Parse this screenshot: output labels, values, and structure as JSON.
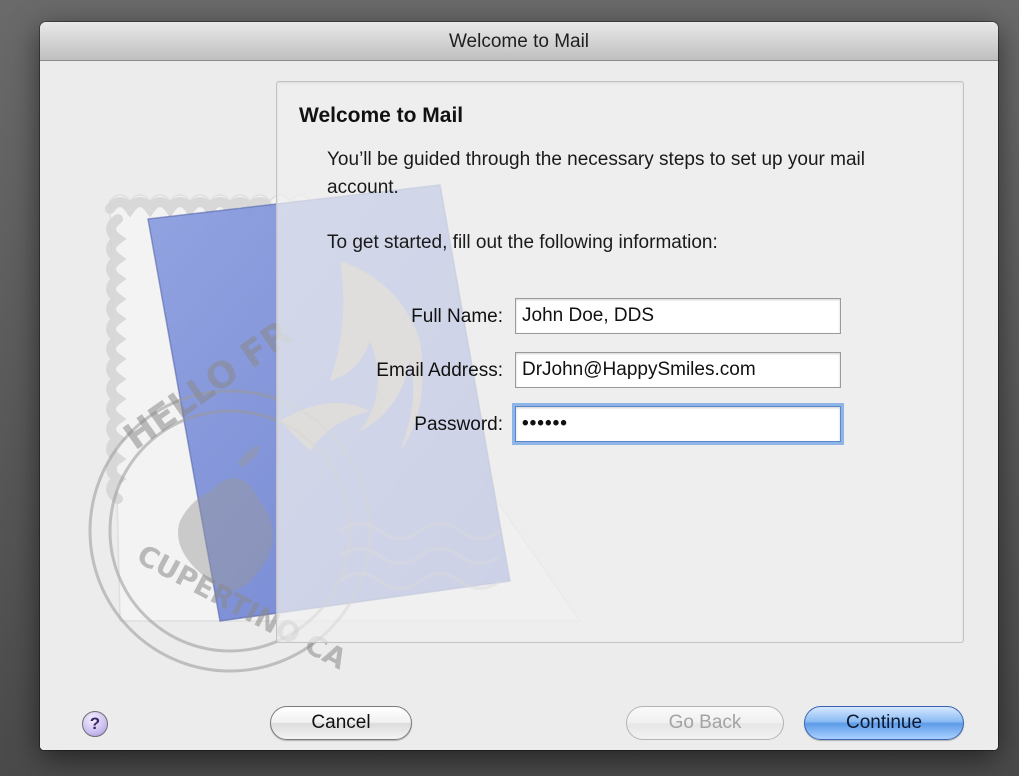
{
  "window": {
    "title": "Welcome to Mail"
  },
  "panel": {
    "title": "Welcome to Mail",
    "intro": "You’ll be guided through the necessary steps to set up your mail account.",
    "instruction": "To get started, fill out the following information:"
  },
  "form": {
    "full_name": {
      "label": "Full Name:",
      "value": "John Doe, DDS"
    },
    "email": {
      "label": "Email Address:",
      "value": "DrJohn@HappySmiles.com"
    },
    "password": {
      "label": "Password:",
      "value": "••••••"
    }
  },
  "stamp": {
    "postmark_top": "HELLO FR",
    "postmark_bottom": "CUPERTINO CA"
  },
  "buttons": {
    "help": "?",
    "cancel": "Cancel",
    "go_back": "Go Back",
    "continue": "Continue"
  },
  "colors": {
    "focus_ring": "#6ea0e6",
    "default_button": "#5e9ce8"
  },
  "icons": {
    "help": "help-icon",
    "app_art": "mail-stamp-icon"
  }
}
